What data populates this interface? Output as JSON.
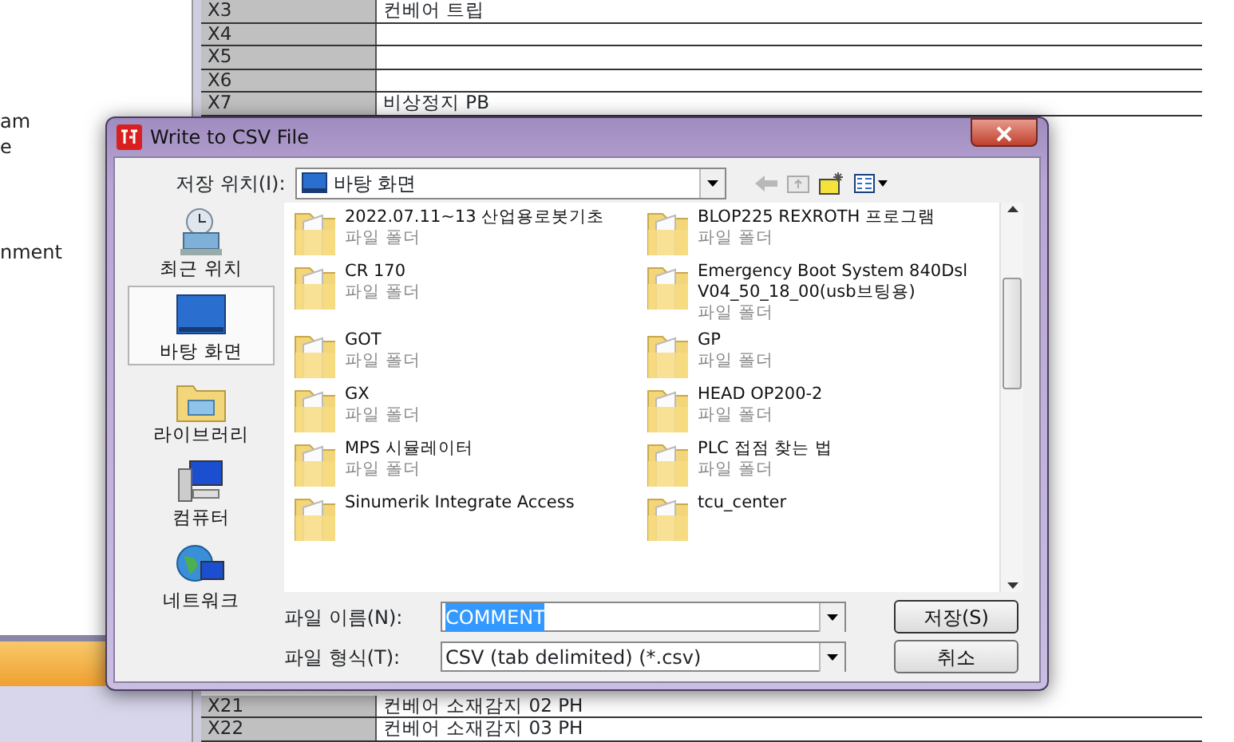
{
  "background": {
    "side_texts": [
      "am",
      "e",
      "nment"
    ],
    "table_top": [
      {
        "id": "X3",
        "comment": "컨베어 트립"
      },
      {
        "id": "X4"
      },
      {
        "id": "X5"
      },
      {
        "id": "X6"
      },
      {
        "id": "X7",
        "comment": "비상정지 PB"
      }
    ],
    "table_bottom": [
      {
        "id": "X21",
        "comment": "컨베어 소재감지 02 PH"
      },
      {
        "id": "X22",
        "comment": "컨베어 소재감지 03 PH"
      }
    ]
  },
  "dialog": {
    "title": "Write to CSV File",
    "location_label": "저장 위치(I):",
    "location": "바탕 화면",
    "places": [
      {
        "label": "최근 위치",
        "selected": false
      },
      {
        "label": "바탕 화면",
        "selected": true
      },
      {
        "label": "라이브러리",
        "selected": false
      },
      {
        "label": "컴퓨터",
        "selected": false
      },
      {
        "label": "네트워크",
        "selected": false
      }
    ],
    "files": [
      {
        "name": "2022.07.11~13 산업용로봇기초",
        "type": "파일 폴더"
      },
      {
        "name": "BLOP225 REXROTH 프로그램",
        "type": "파일 폴더"
      },
      {
        "name": "CR 170",
        "type": "파일 폴더"
      },
      {
        "name": "Emergency Boot System 840Dsl V04_50_18_00(usb브팅용)",
        "type": "파일 폴더"
      },
      {
        "name": "GOT",
        "type": "파일 폴더"
      },
      {
        "name": "GP",
        "type": "파일 폴더"
      },
      {
        "name": "GX",
        "type": "파일 폴더"
      },
      {
        "name": "HEAD OP200-2",
        "type": "파일 폴더"
      },
      {
        "name": "MPS 시뮬레이터",
        "type": "파일 폴더"
      },
      {
        "name": "PLC 접점 찾는 법",
        "type": "파일 폴더"
      },
      {
        "name": "Sinumerik Integrate Access"
      },
      {
        "name": "tcu_center"
      }
    ],
    "filename_label": "파일 이름(N):",
    "filename": "COMMENT",
    "filetype_label": "파일 형식(T):",
    "filetype": "CSV (tab delimited) (*.csv)",
    "buttons": [
      "저장(S)",
      "취소"
    ]
  }
}
